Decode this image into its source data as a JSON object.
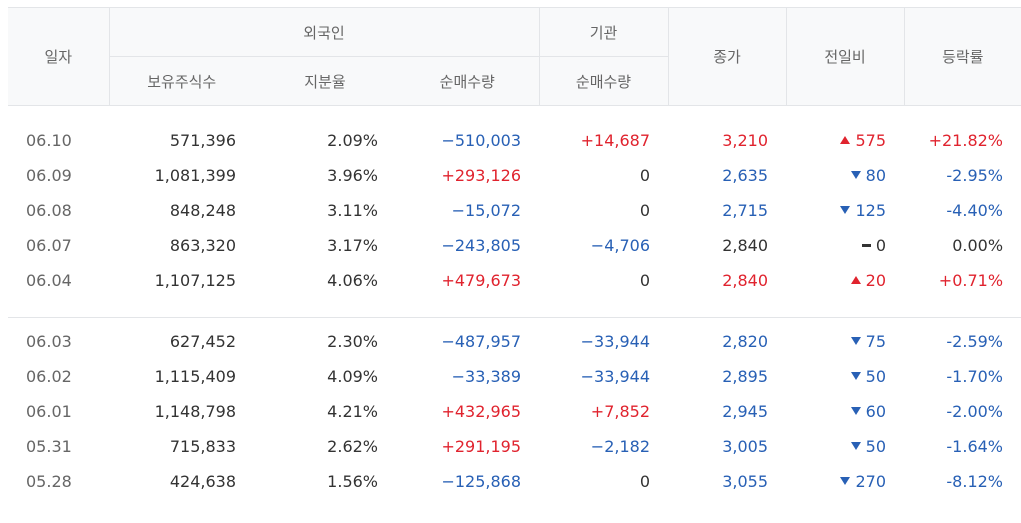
{
  "header": {
    "date": "일자",
    "foreign": "외국인",
    "institution": "기관",
    "close": "종가",
    "change": "전일비",
    "rate": "등락률",
    "holdings": "보유주식수",
    "ratio": "지분율",
    "foreign_net": "순매수량",
    "inst_net": "순매수량"
  },
  "colors": {
    "up": "#e0232e",
    "down": "#2860b5",
    "flat": "#333333"
  },
  "groups": [
    [
      {
        "date": "06.10",
        "holdings": "571,396",
        "ratio": "2.09%",
        "foreign_net": "−510,003",
        "foreign_dir": "down",
        "inst_net": "+14,687",
        "inst_dir": "up",
        "close": "3,210",
        "close_dir": "up",
        "change": "575",
        "change_dir": "up",
        "rate": "+21.82%",
        "rate_dir": "up"
      },
      {
        "date": "06.09",
        "holdings": "1,081,399",
        "ratio": "3.96%",
        "foreign_net": "+293,126",
        "foreign_dir": "up",
        "inst_net": "0",
        "inst_dir": "flat",
        "close": "2,635",
        "close_dir": "down",
        "change": "80",
        "change_dir": "down",
        "rate": "-2.95%",
        "rate_dir": "down"
      },
      {
        "date": "06.08",
        "holdings": "848,248",
        "ratio": "3.11%",
        "foreign_net": "−15,072",
        "foreign_dir": "down",
        "inst_net": "0",
        "inst_dir": "flat",
        "close": "2,715",
        "close_dir": "down",
        "change": "125",
        "change_dir": "down",
        "rate": "-4.40%",
        "rate_dir": "down"
      },
      {
        "date": "06.07",
        "holdings": "863,320",
        "ratio": "3.17%",
        "foreign_net": "−243,805",
        "foreign_dir": "down",
        "inst_net": "−4,706",
        "inst_dir": "down",
        "close": "2,840",
        "close_dir": "flat",
        "change": "0",
        "change_dir": "flat",
        "rate": "0.00%",
        "rate_dir": "flat"
      },
      {
        "date": "06.04",
        "holdings": "1,107,125",
        "ratio": "4.06%",
        "foreign_net": "+479,673",
        "foreign_dir": "up",
        "inst_net": "0",
        "inst_dir": "flat",
        "close": "2,840",
        "close_dir": "up",
        "change": "20",
        "change_dir": "up",
        "rate": "+0.71%",
        "rate_dir": "up"
      }
    ],
    [
      {
        "date": "06.03",
        "holdings": "627,452",
        "ratio": "2.30%",
        "foreign_net": "−487,957",
        "foreign_dir": "down",
        "inst_net": "−33,944",
        "inst_dir": "down",
        "close": "2,820",
        "close_dir": "down",
        "change": "75",
        "change_dir": "down",
        "rate": "-2.59%",
        "rate_dir": "down"
      },
      {
        "date": "06.02",
        "holdings": "1,115,409",
        "ratio": "4.09%",
        "foreign_net": "−33,389",
        "foreign_dir": "down",
        "inst_net": "−33,944",
        "inst_dir": "down",
        "close": "2,895",
        "close_dir": "down",
        "change": "50",
        "change_dir": "down",
        "rate": "-1.70%",
        "rate_dir": "down"
      },
      {
        "date": "06.01",
        "holdings": "1,148,798",
        "ratio": "4.21%",
        "foreign_net": "+432,965",
        "foreign_dir": "up",
        "inst_net": "+7,852",
        "inst_dir": "up",
        "close": "2,945",
        "close_dir": "down",
        "change": "60",
        "change_dir": "down",
        "rate": "-2.00%",
        "rate_dir": "down"
      },
      {
        "date": "05.31",
        "holdings": "715,833",
        "ratio": "2.62%",
        "foreign_net": "+291,195",
        "foreign_dir": "up",
        "inst_net": "−2,182",
        "inst_dir": "down",
        "close": "3,005",
        "close_dir": "down",
        "change": "50",
        "change_dir": "down",
        "rate": "-1.64%",
        "rate_dir": "down"
      },
      {
        "date": "05.28",
        "holdings": "424,638",
        "ratio": "1.56%",
        "foreign_net": "−125,868",
        "foreign_dir": "down",
        "inst_net": "0",
        "inst_dir": "flat",
        "close": "3,055",
        "close_dir": "down",
        "change": "270",
        "change_dir": "down",
        "rate": "-8.12%",
        "rate_dir": "down"
      }
    ]
  ]
}
